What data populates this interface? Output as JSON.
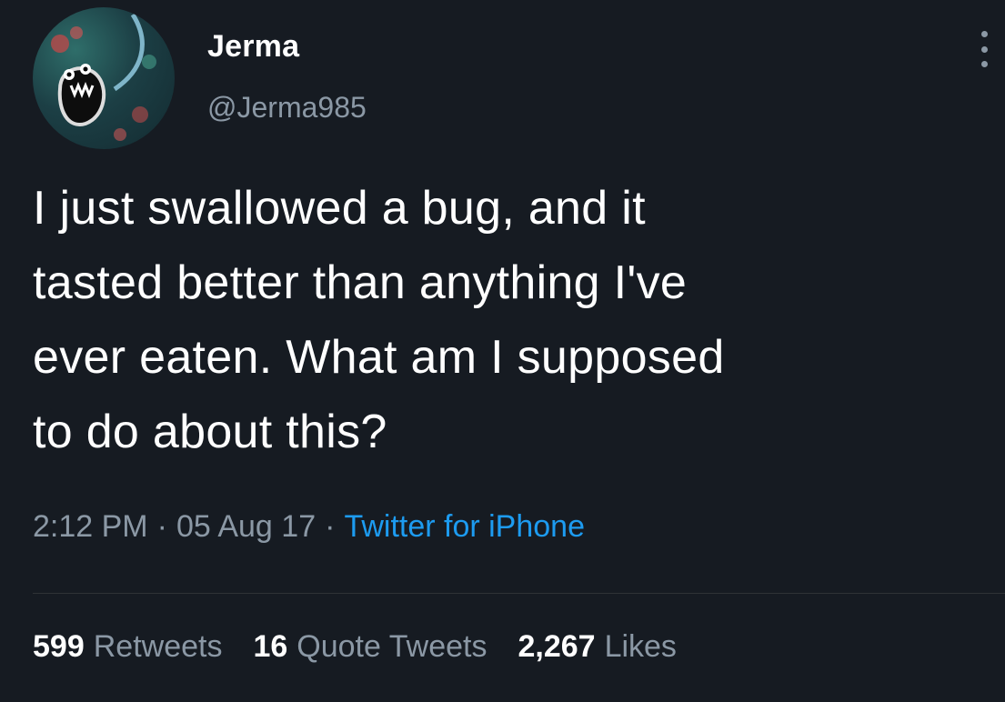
{
  "user": {
    "display_name": "Jerma",
    "handle": "@Jerma985",
    "avatar_icon": "creature-avatar-icon"
  },
  "tweet": {
    "text_lines": [
      "I just swallowed a bug, and it",
      "tasted better than anything I've",
      "ever eaten. What am I supposed",
      "to do about this?"
    ],
    "time": "2:12 PM",
    "separator": "·",
    "date": "05 Aug 17",
    "source": "Twitter for iPhone"
  },
  "stats": {
    "retweets_count": "599",
    "retweets_label": "Retweets",
    "quotes_count": "16",
    "quotes_label": "Quote Tweets",
    "likes_count": "2,267",
    "likes_label": "Likes"
  },
  "colors": {
    "background": "#161b22",
    "secondary_text": "#8b98a5",
    "link": "#1d9bf0",
    "divider": "#2f3336"
  },
  "icons": {
    "more": "more-options-icon"
  }
}
